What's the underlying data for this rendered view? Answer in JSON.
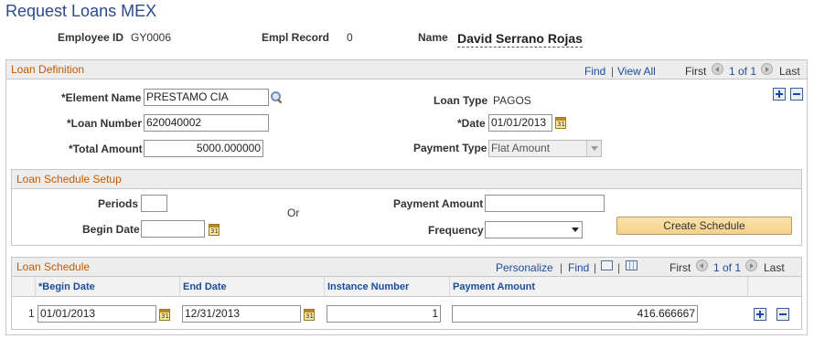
{
  "page": {
    "title": "Request Loans MEX"
  },
  "employee": {
    "id_label": "Employee ID",
    "id_value": "GY0006",
    "record_label": "Empl Record",
    "record_value": "0",
    "name_label": "Name",
    "name_value": "David Serrano Rojas"
  },
  "loan_definition": {
    "title": "Loan Definition",
    "nav": {
      "find": "Find",
      "sep": "|",
      "view_all": "View All",
      "first": "First",
      "range": "1 of 1",
      "last": "Last"
    },
    "element_name_label": "*Element Name",
    "element_name_value": "PRESTAMO CIA",
    "loan_type_label": "Loan Type",
    "loan_type_value": "PAGOS",
    "loan_number_label": "*Loan Number",
    "loan_number_value": "620040002",
    "date_label": "*Date",
    "date_value": "01/01/2013",
    "total_amount_label": "*Total Amount",
    "total_amount_value": "5000.000000",
    "payment_type_label": "Payment Type",
    "payment_type_value": "Flat Amount"
  },
  "schedule_setup": {
    "title": "Loan Schedule Setup",
    "periods_label": "Periods",
    "periods_value": "",
    "or_text": "Or",
    "payment_amount_label": "Payment Amount",
    "payment_amount_value": "",
    "begin_date_label": "Begin Date",
    "begin_date_value": "",
    "frequency_label": "Frequency",
    "frequency_value": "",
    "create_button": "Create Schedule"
  },
  "loan_schedule": {
    "title": "Loan Schedule",
    "nav": {
      "personalize": "Personalize",
      "sep": "|",
      "find": "Find",
      "first": "First",
      "range": "1 of 1",
      "last": "Last"
    },
    "columns": [
      "*Begin Date",
      "End Date",
      "Instance Number",
      "Payment Amount"
    ],
    "rows": [
      {
        "num": "1",
        "begin": "01/01/2013",
        "end": "12/31/2013",
        "instance": "1",
        "amount": "416.666667"
      }
    ]
  }
}
